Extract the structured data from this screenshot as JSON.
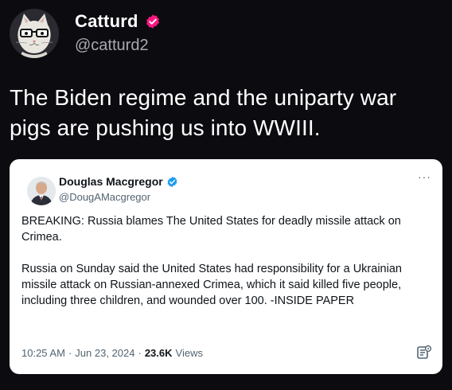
{
  "outer": {
    "name": "Catturd",
    "handle": "@catturd2",
    "text": "The Biden regime and the uniparty war pigs are pushing us into WWIII.",
    "avatar_icon": "cat-with-glasses-avatar-icon",
    "verified_color": "#f91880"
  },
  "quote": {
    "name": "Douglas Macgregor",
    "handle": "@DougAMacgregor",
    "more": "···",
    "verified_color": "#1d9bf0",
    "avatar_icon": "man-in-suit-avatar-icon",
    "paragraphs": [
      "BREAKING: Russia blames The United States for deadly missile attack on Crimea.",
      "Russia on Sunday said the United States had responsibility for a Ukrainian missile attack on Russian-annexed Crimea, which it said killed five people, including three children, and wounded over 100. -INSIDE PAPER"
    ],
    "time": "10:25 AM",
    "date": "Jun 23, 2024",
    "sep": "·",
    "views_count": "23.6K",
    "views_label": "Views",
    "grok_icon": "grok-icon"
  },
  "colors": {
    "background": "#0b0b10",
    "card": "#ffffff",
    "secondary_text": "#536471"
  }
}
